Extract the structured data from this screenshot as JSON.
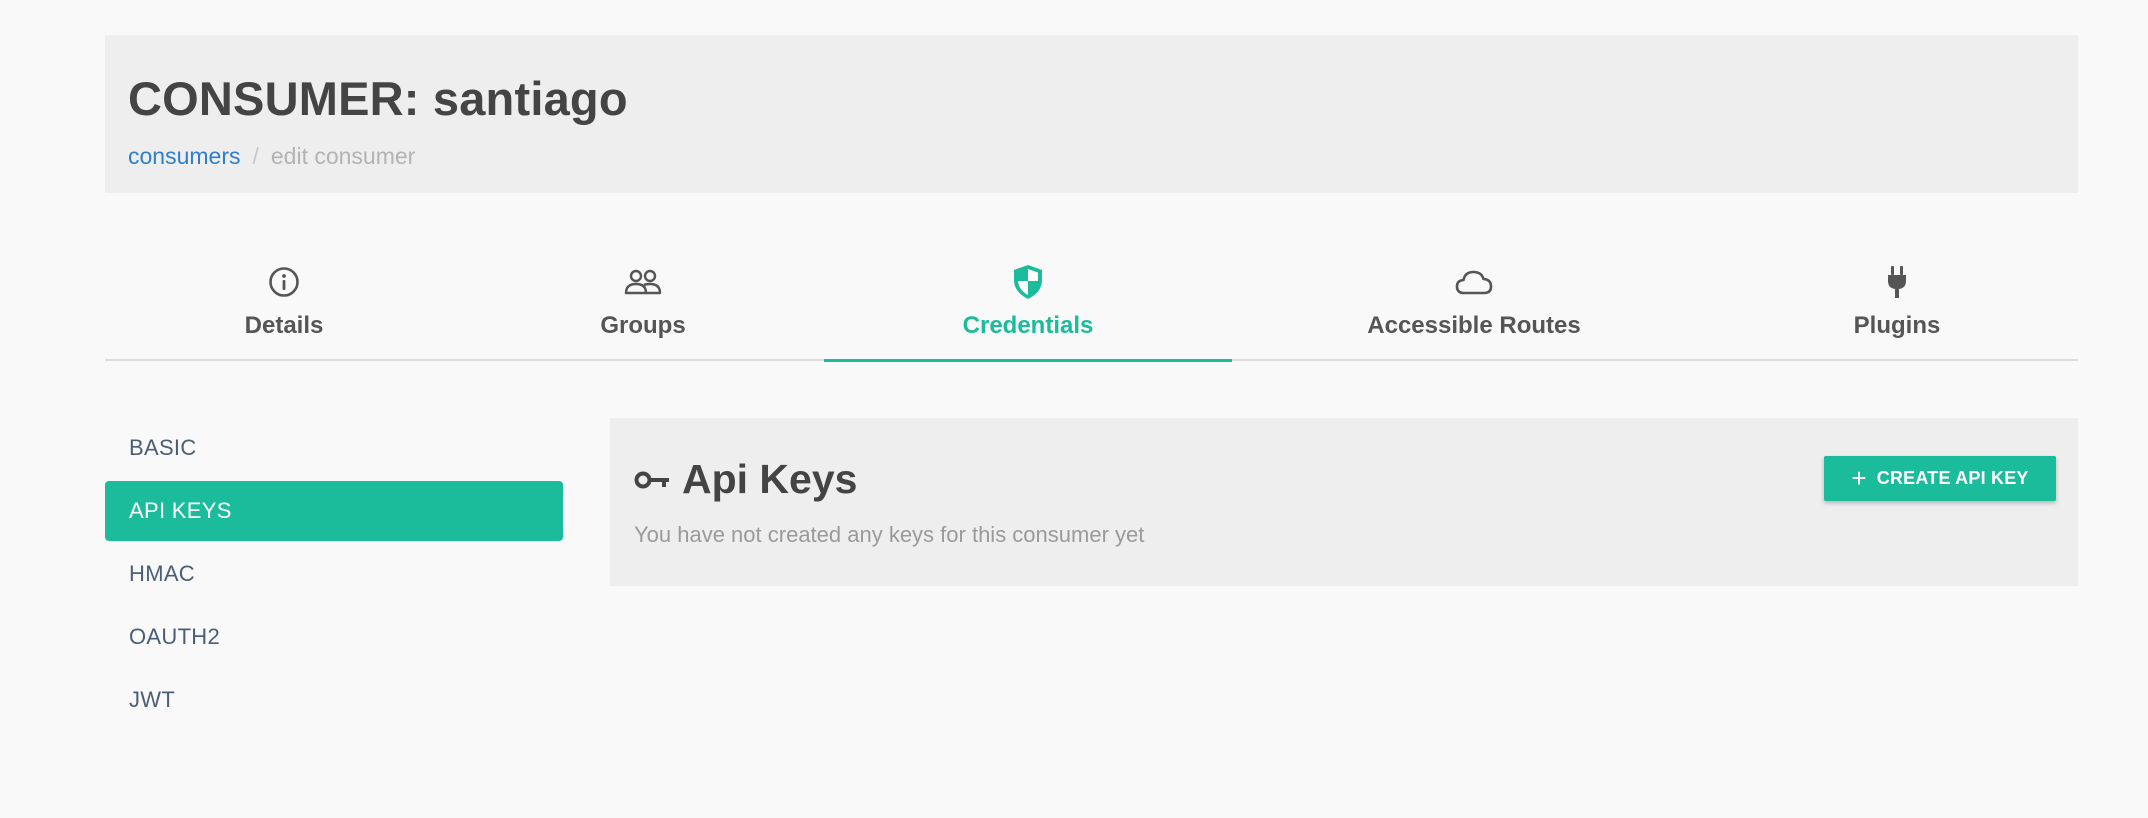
{
  "header": {
    "title": "CONSUMER: santiago",
    "breadcrumb": {
      "link": "consumers",
      "separator": "/",
      "current": "edit consumer"
    }
  },
  "tabs": [
    {
      "label": "Details",
      "icon": "info-circle-icon"
    },
    {
      "label": "Groups",
      "icon": "users-icon"
    },
    {
      "label": "Credentials",
      "icon": "shield-icon",
      "active": true
    },
    {
      "label": "Accessible Routes",
      "icon": "cloud-icon"
    },
    {
      "label": "Plugins",
      "icon": "plug-icon"
    }
  ],
  "side_menu": {
    "items": [
      {
        "label": "BASIC"
      },
      {
        "label": "API KEYS",
        "active": true
      },
      {
        "label": "HMAC"
      },
      {
        "label": "OAUTH2"
      },
      {
        "label": "JWT"
      }
    ]
  },
  "panel": {
    "title": "Api Keys",
    "title_icon": "key-icon",
    "empty_message": "You have not created any keys for this consumer yet",
    "create_button": {
      "plus": "+",
      "label": "CREATE API KEY"
    }
  },
  "colors": {
    "accent": "#1abc9c",
    "link": "#2e7fc9",
    "heading": "#444444",
    "panel_bg": "#eeeeee",
    "page_bg": "#f9f9f9"
  }
}
